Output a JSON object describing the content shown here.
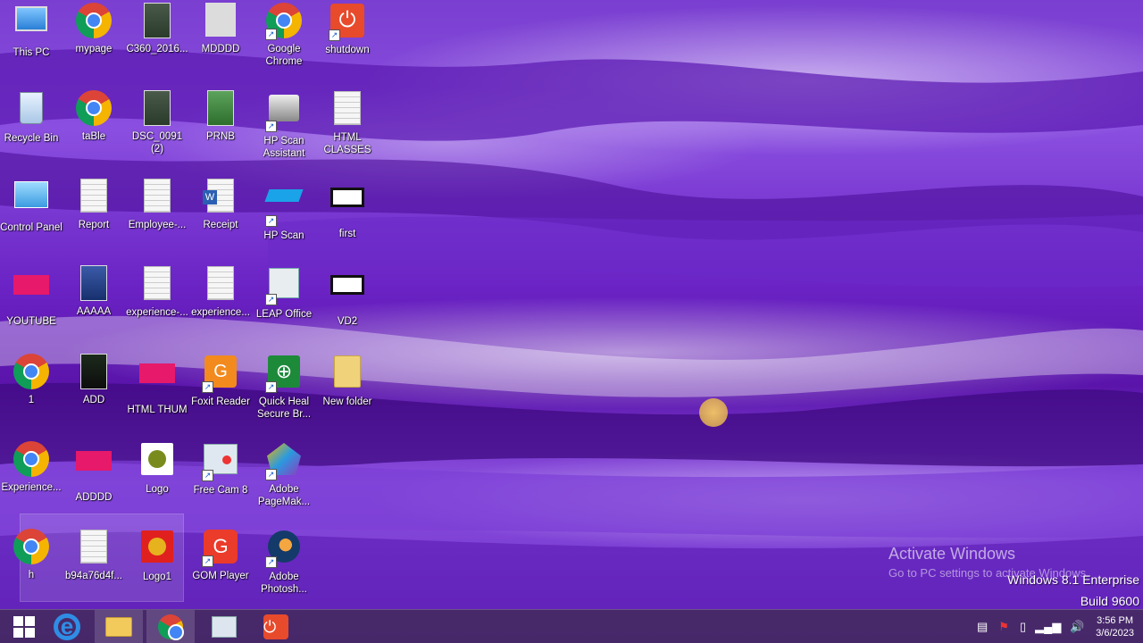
{
  "desktop": {
    "icons": [
      {
        "label": "This PC",
        "type": "computer"
      },
      {
        "label": "mypage",
        "type": "chrome"
      },
      {
        "label": "C360_2016...",
        "type": "photo"
      },
      {
        "label": "MDDDD",
        "type": "photo-light"
      },
      {
        "label": "Google Chrome",
        "type": "chrome"
      },
      {
        "label": "shutdown",
        "type": "shutdown"
      },
      {
        "label": "Recycle Bin",
        "type": "recycle"
      },
      {
        "label": "taBle",
        "type": "chrome"
      },
      {
        "label": "DSC_0091 (2)",
        "type": "photo"
      },
      {
        "label": "PRNB",
        "type": "photo-green"
      },
      {
        "label": "HP Scan Assistant",
        "type": "printer"
      },
      {
        "label": "HTML CLASSES",
        "type": "doc"
      },
      {
        "label": "Control Panel",
        "type": "control"
      },
      {
        "label": "Report",
        "type": "doc"
      },
      {
        "label": "Employee-...",
        "type": "doc"
      },
      {
        "label": "Receipt",
        "type": "word"
      },
      {
        "label": "HP Scan",
        "type": "scan"
      },
      {
        "label": "first",
        "type": "white-screen"
      },
      {
        "label": "YOUTUBE",
        "type": "pink"
      },
      {
        "label": "AAAAA",
        "type": "photo-blue"
      },
      {
        "label": "experience-...",
        "type": "doc"
      },
      {
        "label": "experience...",
        "type": "doc"
      },
      {
        "label": "LEAP Office",
        "type": "leap"
      },
      {
        "label": "VD2",
        "type": "white-screen"
      },
      {
        "label": "1",
        "type": "chrome"
      },
      {
        "label": "ADD",
        "type": "photo-dark"
      },
      {
        "label": "HTML THUM",
        "type": "pink"
      },
      {
        "label": "Foxit Reader",
        "type": "foxit"
      },
      {
        "label": "Quick Heal Secure Br...",
        "type": "quickheal"
      },
      {
        "label": "New folder",
        "type": "folder"
      },
      {
        "label": "Experience...",
        "type": "chrome"
      },
      {
        "label": "ADDDD",
        "type": "pink"
      },
      {
        "label": "Logo",
        "type": "logo"
      },
      {
        "label": "Free Cam 8",
        "type": "freecam"
      },
      {
        "label": "Adobe PageMak...",
        "type": "pagemaker"
      },
      {
        "label": "h",
        "type": "chrome"
      },
      {
        "label": "b94a76d4f...",
        "type": "doc"
      },
      {
        "label": "Logo1",
        "type": "logo-red"
      },
      {
        "label": "GOM Player",
        "type": "gom"
      },
      {
        "label": "Adobe Photosh...",
        "type": "photoshop"
      }
    ],
    "watermark_title": "Activate Windows",
    "watermark_sub": "Go to PC settings to activate Windows.",
    "edition_line1": "Windows 8.1 Enterprise",
    "edition_line2": "Build 9600"
  },
  "taskbar": {
    "pinned": [
      {
        "name": "start",
        "icon": "windows-logo-icon"
      },
      {
        "name": "internet-explorer",
        "icon": "internet-explorer-icon"
      },
      {
        "name": "file-explorer",
        "icon": "file-explorer-icon"
      },
      {
        "name": "google-chrome",
        "icon": "chrome-icon"
      },
      {
        "name": "free-cam",
        "icon": "free-cam-icon"
      },
      {
        "name": "shutdown",
        "icon": "shutdown-icon"
      }
    ],
    "clock_time": "3:56 PM",
    "clock_date": "3/6/2023"
  }
}
